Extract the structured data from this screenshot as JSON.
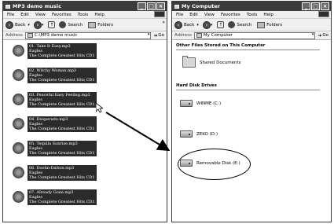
{
  "left_window": {
    "title": "MP3 demo music",
    "menu": [
      "File",
      "Edit",
      "View",
      "Favorites",
      "Tools",
      "Help"
    ],
    "toolbar": {
      "back": "Back",
      "search": "Search",
      "folders": "Folders",
      "more": "»"
    },
    "address": {
      "label": "Address",
      "value": "C:\\MP3 demo music",
      "go": "Go"
    },
    "files": [
      {
        "name": "01. Take It Easy.mp3",
        "artist": "Eagles",
        "album": "The Complete Greatest Hits CD1"
      },
      {
        "name": "02. Witchy Woman.mp3",
        "artist": "Eagles",
        "album": "The Complete Greatest Hits CD1"
      },
      {
        "name": "03. Peaceful Easy Feeling.mp3",
        "artist": "Eagles",
        "album": "The Complete Greatest Hits CD1"
      },
      {
        "name": "04. Desperado.mp3",
        "artist": "Eagles",
        "album": "The Complete Greatest Hits CD1"
      },
      {
        "name": "05. Tequila Sunrise.mp3",
        "artist": "Eagles",
        "album": "The Complete Greatest Hits CD1"
      },
      {
        "name": "06. Doolin-Dalton.mp3",
        "artist": "Eagles",
        "album": "The Complete Greatest Hits CD1"
      },
      {
        "name": "07. Already Gone.mp3",
        "artist": "Eagles",
        "album": "The Complete Greatest Hits CD1"
      }
    ]
  },
  "right_window": {
    "title": "My Computer",
    "menu": [
      "File",
      "Edit",
      "View",
      "Favorites",
      "Tools",
      "Help"
    ],
    "toolbar": {
      "back": "Back",
      "search": "Search",
      "folders": "Folders"
    },
    "address": {
      "label": "Address",
      "value": "My Computer",
      "go": "Go"
    },
    "section_files": "Other Files Stored on This Computer",
    "shared_documents": "Shared Documents",
    "section_drives": "Hard Disk Drives",
    "drives": [
      {
        "label": "WINME (C:)"
      },
      {
        "label": "ZEKO (D:)"
      },
      {
        "label": "Removable Disk (E:)"
      }
    ]
  },
  "icons": {
    "title_icon": "folder-icon",
    "file_icon": "audio-file-icon",
    "drive_icon": "hard-disk-icon",
    "removable_icon": "removable-disk-icon",
    "pointer": "mouse-pointer-icon"
  }
}
